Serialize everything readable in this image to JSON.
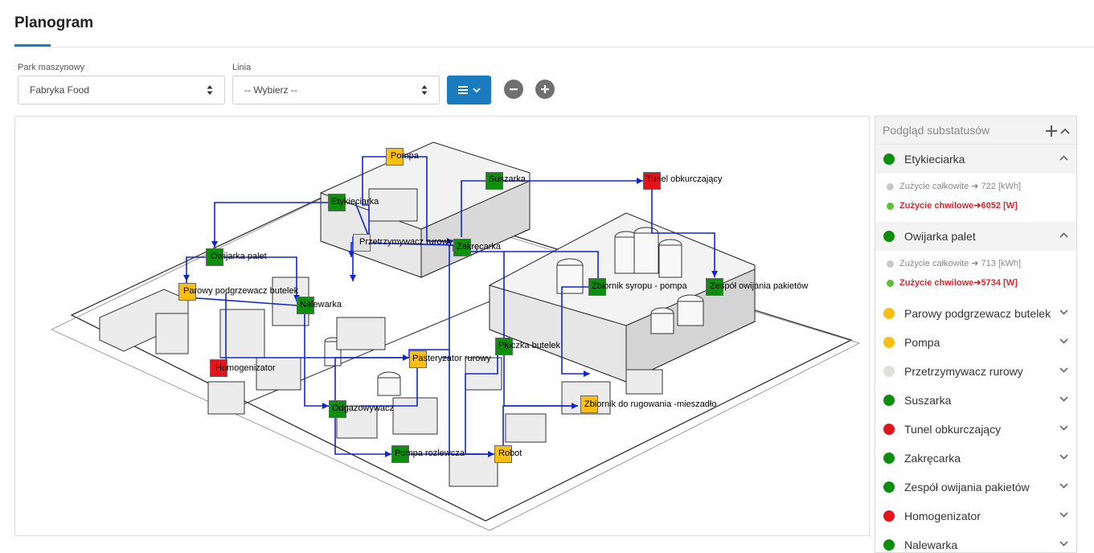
{
  "page": {
    "title": "Planogram"
  },
  "filters": {
    "park_label": "Park maszynowy",
    "park_value": "Fabryka Food",
    "line_label": "Linia",
    "line_value": "-- Wybierz --",
    "menu_icon": "list-chevron-icon",
    "zoom_out_icon": "minus-icon",
    "zoom_in_icon": "plus-icon"
  },
  "colors": {
    "green": "#0d8f0d",
    "yellow": "#f9bf12",
    "red": "#e3141b",
    "gray": "#e0e0dc",
    "accent": "#1a7bbf",
    "connector": "#1326c8"
  },
  "map": {
    "nodes": [
      {
        "label": "Pompa",
        "status": "yellow"
      },
      {
        "label": "Suszarka",
        "status": "green"
      },
      {
        "label": "Tunel obkurczający",
        "status": "red"
      },
      {
        "label": "Etykieciarka",
        "status": "green"
      },
      {
        "label": "Przetrzymywacz rurowy",
        "status": "gray"
      },
      {
        "label": "Zakręcarka",
        "status": "green"
      },
      {
        "label": "Owijarka palet",
        "status": "green"
      },
      {
        "label": "Parowy podgrzewacz butelek",
        "status": "yellow"
      },
      {
        "label": "Nalewarka",
        "status": "green"
      },
      {
        "label": "Zbiornik syropu - pompa",
        "status": "green"
      },
      {
        "label": "Zespół owijania pakietów",
        "status": "green"
      },
      {
        "label": "Płuczka butelek",
        "status": "green"
      },
      {
        "label": "Pasteryzator rurowy",
        "status": "yellow"
      },
      {
        "label": "Homogenizator",
        "status": "red"
      },
      {
        "label": "Odgazowywacz",
        "status": "green"
      },
      {
        "label": "Zbiornik do rugowania -mieszadło",
        "status": "yellow"
      },
      {
        "label": "Pompa rozlewcza",
        "status": "green"
      },
      {
        "label": "Robot",
        "status": "yellow"
      }
    ]
  },
  "panel": {
    "title": "Podgląd substatusów",
    "add_icon": "plus-icon",
    "collapse_icon": "chevron-up-icon",
    "items": [
      {
        "name": "Etykieciarka",
        "status": "green",
        "expanded": true,
        "total_label": "Zużycie całkowite",
        "total_value": "722 [kWh]",
        "now_label": "Zużycie chwilowe",
        "now_value": "6052 [W]"
      },
      {
        "name": "Owijarka palet",
        "status": "green",
        "expanded": true,
        "total_label": "Zużycie całkowite",
        "total_value": "713 [kWh]",
        "now_label": "Zużycie chwilowe",
        "now_value": "5734 [W]"
      },
      {
        "name": "Parowy podgrzewacz butelek",
        "status": "yellow",
        "expanded": false
      },
      {
        "name": "Pompa",
        "status": "yellow",
        "expanded": false
      },
      {
        "name": "Przetrzymywacz rurowy",
        "status": "gray",
        "expanded": false
      },
      {
        "name": "Suszarka",
        "status": "green",
        "expanded": false
      },
      {
        "name": "Tunel obkurczający",
        "status": "red",
        "expanded": false
      },
      {
        "name": "Zakręcarka",
        "status": "green",
        "expanded": false
      },
      {
        "name": "Zespół owijania pakietów",
        "status": "green",
        "expanded": false
      },
      {
        "name": "Homogenizator",
        "status": "red",
        "expanded": false
      },
      {
        "name": "Nalewarka",
        "status": "green",
        "expanded": false
      }
    ]
  }
}
